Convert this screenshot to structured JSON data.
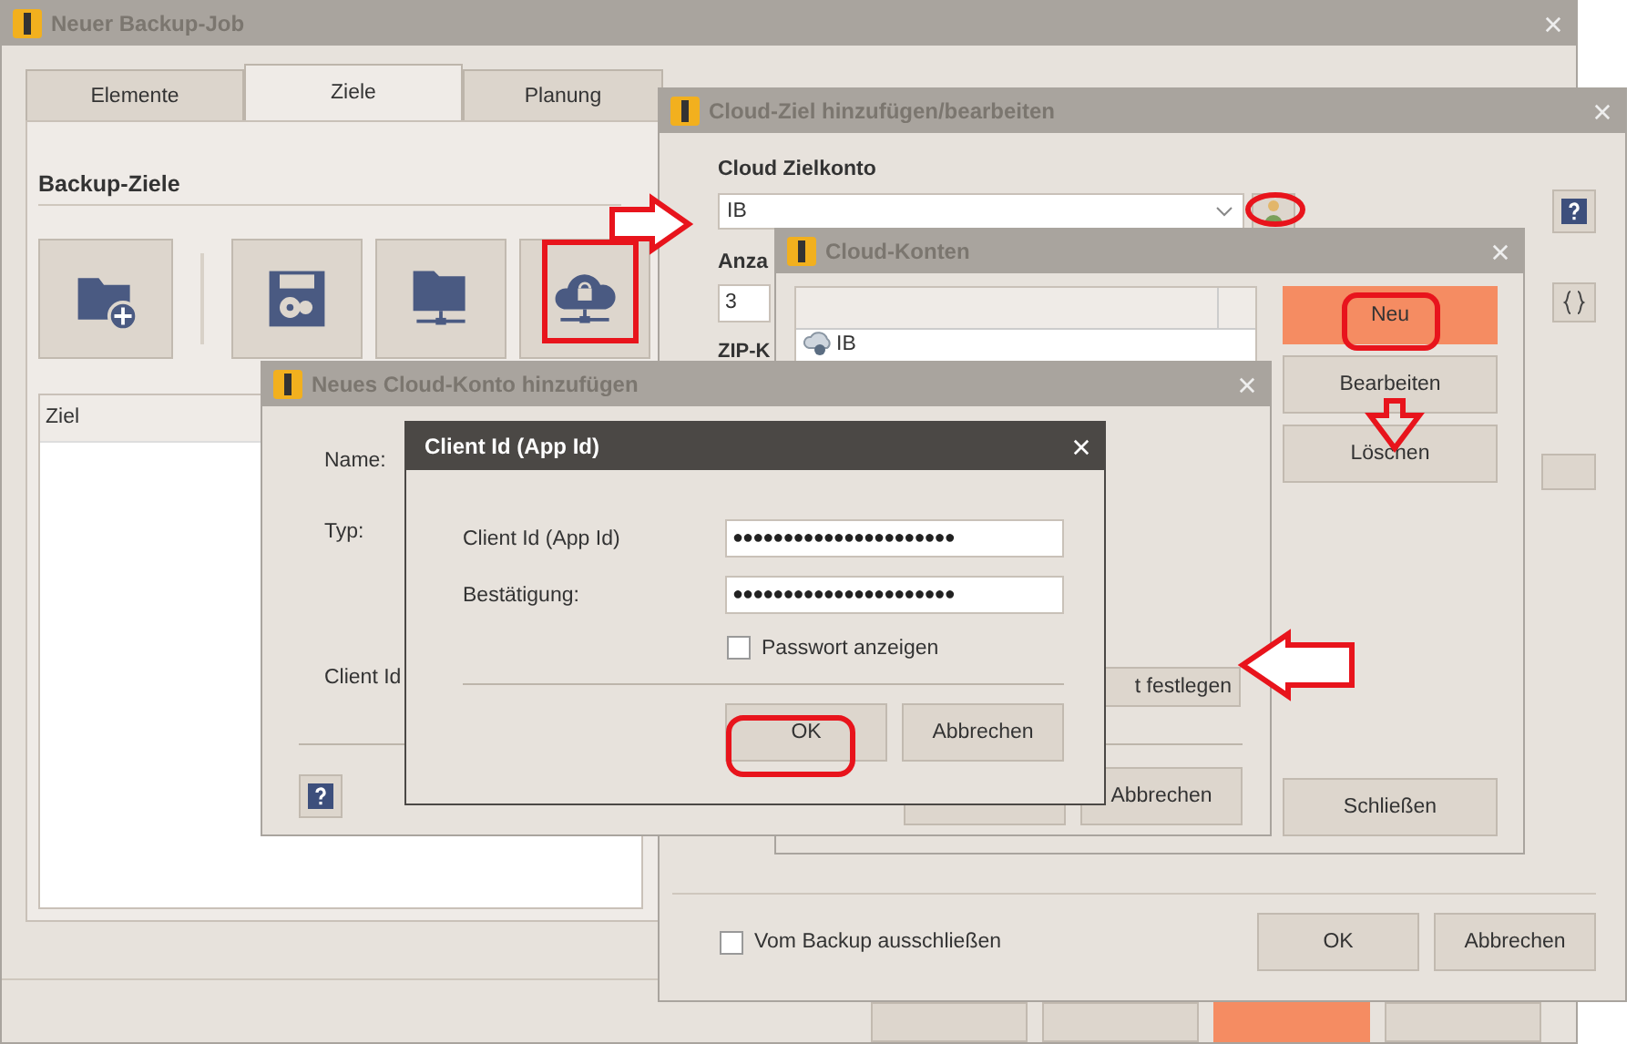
{
  "main_window": {
    "title": "Neuer Backup-Job",
    "active": false,
    "tabs": [
      {
        "label": "Elemente",
        "selected": false
      },
      {
        "label": "Ziele",
        "selected": true
      },
      {
        "label": "Planung",
        "selected": false
      }
    ],
    "section_title": "Backup-Ziele",
    "target_types": [
      {
        "kind": "folder"
      },
      {
        "kind": "disk"
      },
      {
        "kind": "ftp"
      },
      {
        "kind": "cloud"
      }
    ],
    "list_column": "Ziel",
    "footer_buttons": [
      {
        "primary": false
      },
      {
        "primary": false
      },
      {
        "primary": true
      },
      {
        "primary": false
      }
    ]
  },
  "cloud_target_window": {
    "title": "Cloud-Ziel hinzufügen/bearbeiten",
    "active": false,
    "account_label": "Cloud Zielkonto",
    "account_value": "IB",
    "count_label": "Anza",
    "count_value": "3",
    "zip_label": "ZIP-K",
    "exclude": {
      "label": "Vom Backup ausschließen",
      "checked": false
    },
    "buttons": [
      "OK",
      "Abbrechen"
    ]
  },
  "cloud_accounts_window": {
    "title": "Cloud-Konten",
    "active": false,
    "accounts": [
      {
        "name": "IB"
      }
    ],
    "buttons": [
      {
        "label": "Neu",
        "primary": true
      },
      {
        "label": "Bearbeiten",
        "primary": false
      },
      {
        "label": "Löschen",
        "primary": false
      }
    ],
    "close_button": "Schließen"
  },
  "new_account_window": {
    "title": "Neues Cloud-Konto hinzufügen",
    "active": false,
    "labels": [
      "Name:",
      "Typ:",
      "Client Id"
    ],
    "set_button": "t festlegen",
    "cancel_button": "Abbrechen"
  },
  "client_id_dialog": {
    "title": "Client Id (App Id)",
    "active": true,
    "fields": [
      {
        "label": "Client Id (App Id)",
        "value": "●●●●●●●●●●●●●●●●●●●●●●"
      },
      {
        "label": "Bestätigung:",
        "value": "●●●●●●●●●●●●●●●●●●●●●●"
      }
    ],
    "show_password": {
      "label": "Passwort anzeigen",
      "checked": false
    },
    "buttons": [
      "OK",
      "Abbrechen"
    ]
  }
}
